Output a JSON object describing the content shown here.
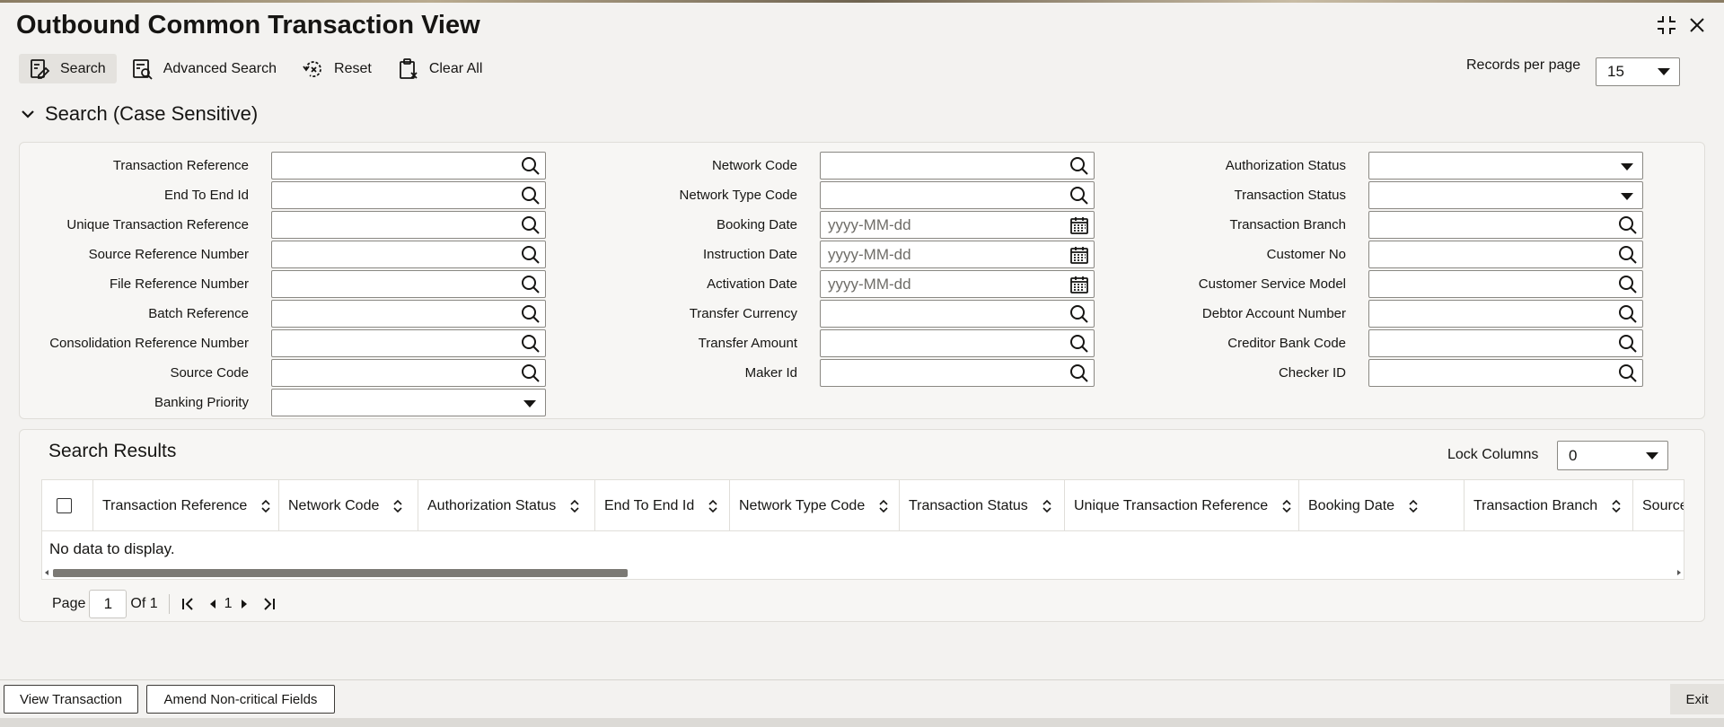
{
  "window": {
    "title": "Outbound Common Transaction View",
    "controls": [
      "minimize-icon",
      "close-icon"
    ]
  },
  "toolbar": {
    "search_label": "Search",
    "advanced_search_label": "Advanced Search",
    "reset_label": "Reset",
    "clear_all_label": "Clear All",
    "records_per_page_label": "Records per page",
    "records_per_page_value": "15"
  },
  "search_section": {
    "title": "Search (Case Sensitive)",
    "date_placeholder": "yyyy-MM-dd",
    "col1": [
      {
        "label": "Transaction Reference",
        "type": "lookup"
      },
      {
        "label": "End To End Id",
        "type": "lookup"
      },
      {
        "label": "Unique Transaction Reference",
        "type": "lookup"
      },
      {
        "label": "Source Reference Number",
        "type": "lookup"
      },
      {
        "label": "File Reference Number",
        "type": "lookup"
      },
      {
        "label": "Batch Reference",
        "type": "lookup"
      },
      {
        "label": "Consolidation Reference Number",
        "type": "lookup"
      },
      {
        "label": "Source Code",
        "type": "lookup"
      },
      {
        "label": "Banking Priority",
        "type": "select"
      }
    ],
    "col2": [
      {
        "label": "Network Code",
        "type": "lookup"
      },
      {
        "label": "Network Type Code",
        "type": "lookup"
      },
      {
        "label": "Booking Date",
        "type": "date"
      },
      {
        "label": "Instruction Date",
        "type": "date"
      },
      {
        "label": "Activation Date",
        "type": "date"
      },
      {
        "label": "Transfer Currency",
        "type": "lookup"
      },
      {
        "label": "Transfer Amount",
        "type": "lookup"
      },
      {
        "label": "Maker Id",
        "type": "lookup"
      }
    ],
    "col3": [
      {
        "label": "Authorization Status",
        "type": "select"
      },
      {
        "label": "Transaction Status",
        "type": "select"
      },
      {
        "label": "Transaction Branch",
        "type": "lookup"
      },
      {
        "label": "Customer No",
        "type": "lookup"
      },
      {
        "label": "Customer Service Model",
        "type": "lookup"
      },
      {
        "label": "Debtor Account Number",
        "type": "lookup"
      },
      {
        "label": "Creditor Bank Code",
        "type": "lookup"
      },
      {
        "label": "Checker ID",
        "type": "lookup"
      }
    ]
  },
  "results": {
    "title": "Search Results",
    "lock_columns_label": "Lock Columns",
    "lock_columns_value": "0",
    "columns": [
      "Transaction Reference",
      "Network Code",
      "Authorization Status",
      "End To End Id",
      "Network Type Code",
      "Transaction Status",
      "Unique Transaction Reference",
      "Booking Date",
      "Transaction Branch",
      "Source Re"
    ],
    "empty_text": "No data to display."
  },
  "pager": {
    "page_label": "Page",
    "page_value": "1",
    "of_label": "Of 1",
    "current_page": "1"
  },
  "footer": {
    "view_transaction_label": "View Transaction",
    "amend_label": "Amend Non-critical Fields",
    "exit_label": "Exit"
  }
}
